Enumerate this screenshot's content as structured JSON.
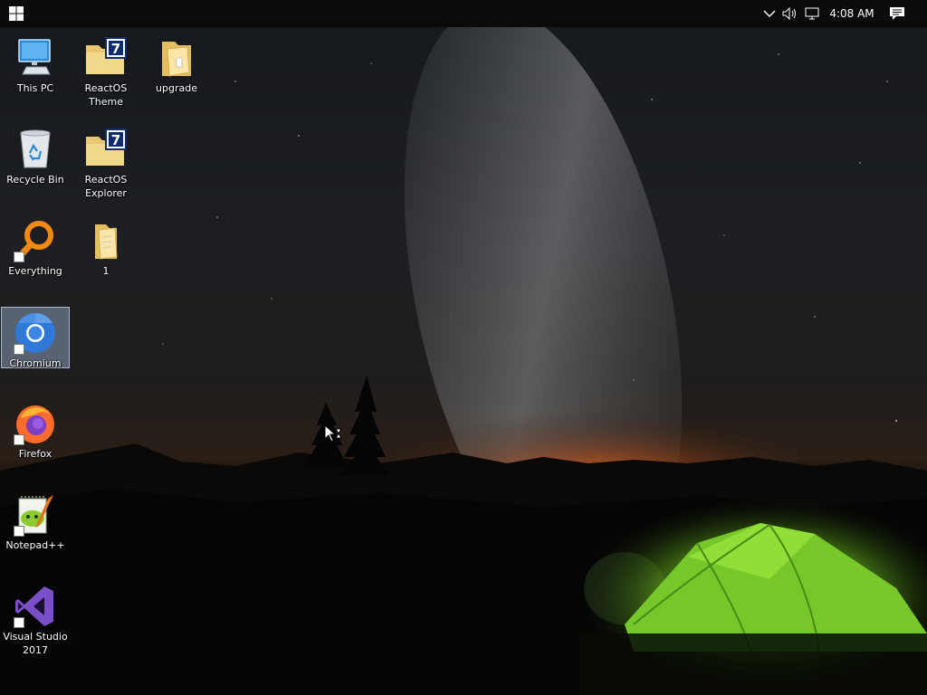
{
  "taskbar": {
    "start_icon": "windows-start-icon",
    "tray_icons": [
      "chevron-up-icon",
      "volume-icon",
      "network-icon"
    ],
    "clock": "4:08 AM",
    "notification_icon": "action-center-icon"
  },
  "desktop": {
    "icons": [
      {
        "label": "This PC",
        "icon": "computer-icon"
      },
      {
        "label": "ReactOS Theme",
        "icon": "7z-folder-icon"
      },
      {
        "label": "upgrade",
        "icon": "folder-icon"
      },
      {
        "label": "Recycle Bin",
        "icon": "recycle-bin-icon"
      },
      {
        "label": "ReactOS Explorer",
        "icon": "7z-folder-icon"
      },
      {
        "label": "Everything",
        "icon": "everything-icon"
      },
      {
        "label": "1",
        "icon": "folder-icon"
      },
      {
        "label": "Chromium",
        "icon": "chromium-icon",
        "selected": true
      },
      {
        "label": "Firefox",
        "icon": "firefox-icon"
      },
      {
        "label": "Notepad++",
        "icon": "notepad-plus-plus-icon"
      },
      {
        "label": "Visual Studio 2017",
        "icon": "visual-studio-icon"
      }
    ]
  },
  "wallpaper": {
    "description_icon": "night-sky-tent-wallpaper"
  },
  "colors": {
    "taskbar": "#0b0b0b",
    "selection": "#a0b9d7",
    "tent": "#7fd62a",
    "glow": "#d9621c"
  }
}
